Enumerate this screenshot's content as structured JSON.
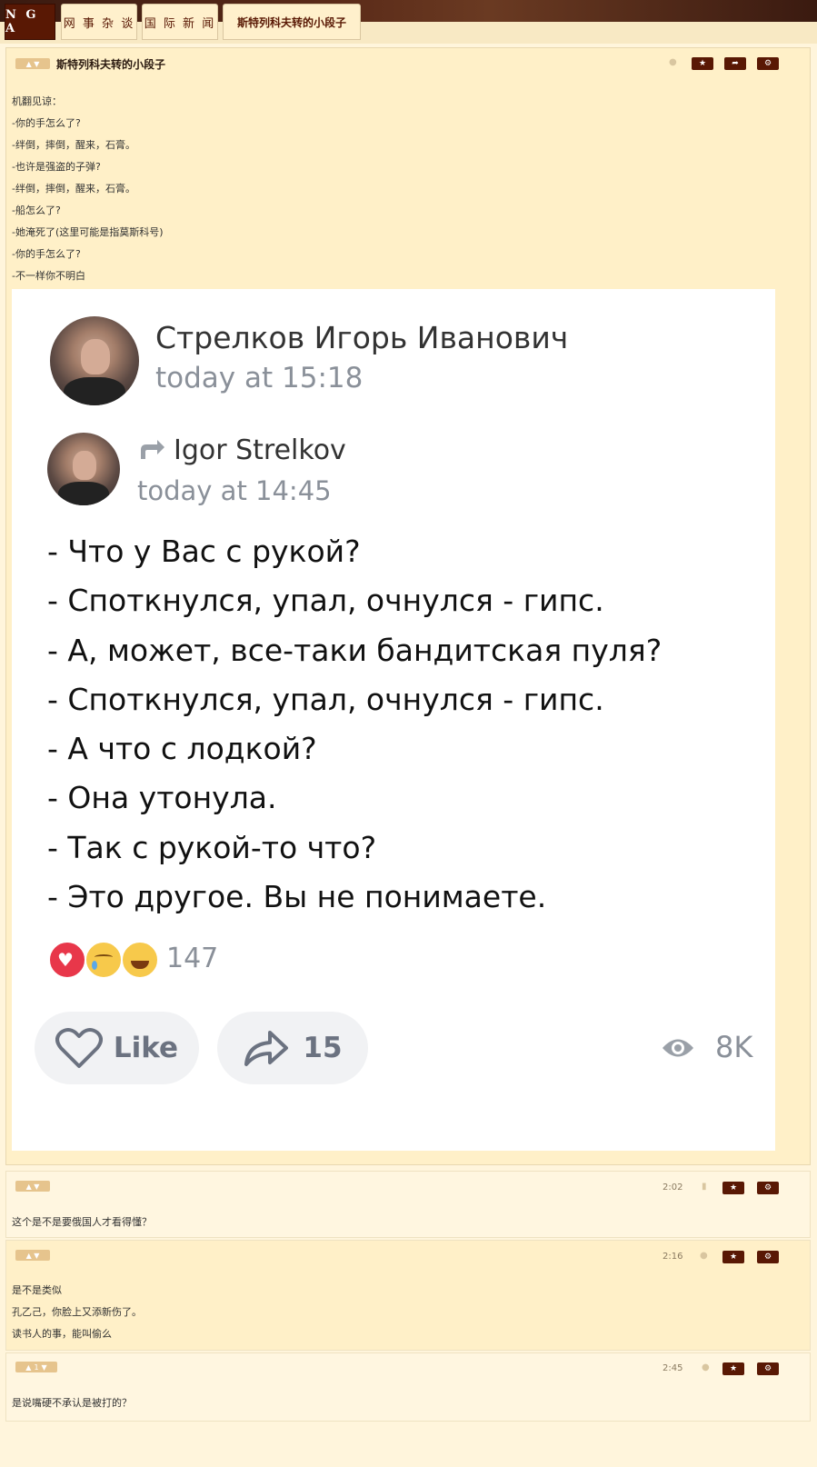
{
  "nav": {
    "logo": "N G A",
    "tabs": [
      "网 事 杂 谈",
      "国 际 新 闻",
      "斯特列科夫转的小段子"
    ]
  },
  "main_post": {
    "title": "斯特列科夫转的小段子",
    "lines": [
      "机翻见谅：",
      "-你的手怎么了?",
      "-绊倒，摔倒，醒来，石膏。",
      "-也许是强盗的子弹?",
      "-绊倒，摔倒，醒来，石膏。",
      "-船怎么了?",
      "-她淹死了(这里可能是指莫斯科号)",
      "-你的手怎么了?",
      "-不一样你不明白"
    ]
  },
  "screenshot": {
    "author": "Стрелков Игорь Иванович",
    "author_time": "today at 15:18",
    "forward_author": "Igor Strelkov",
    "forward_time": "today at 14:45",
    "lines": [
      "- Что у Вас с рукой?",
      "- Споткнулся, упал, очнулся - гипс.",
      "- А, может, все-таки бандитская пуля?",
      "- Споткнулся, упал, очнулся - гипс.",
      "- А что с лодкой?",
      "- Она утонула.",
      "- Так с рукой-то что?",
      "- Это другое. Вы не понимаете."
    ],
    "reactions_count": "147",
    "like_label": "Like",
    "share_count": "15",
    "views": "8K"
  },
  "replies": [
    {
      "time": "2:02",
      "lines": [
        "这个是不是要俄国人才看得懂？"
      ]
    },
    {
      "time": "2:16",
      "lines": [
        "是不是类似",
        "孔乙己，你脸上又添新伤了。",
        "读书人的事，能叫偷么"
      ]
    },
    {
      "time": "2:45",
      "like_badge": "1",
      "lines": [
        "是说嘴硬不承认是被打的？"
      ]
    }
  ]
}
